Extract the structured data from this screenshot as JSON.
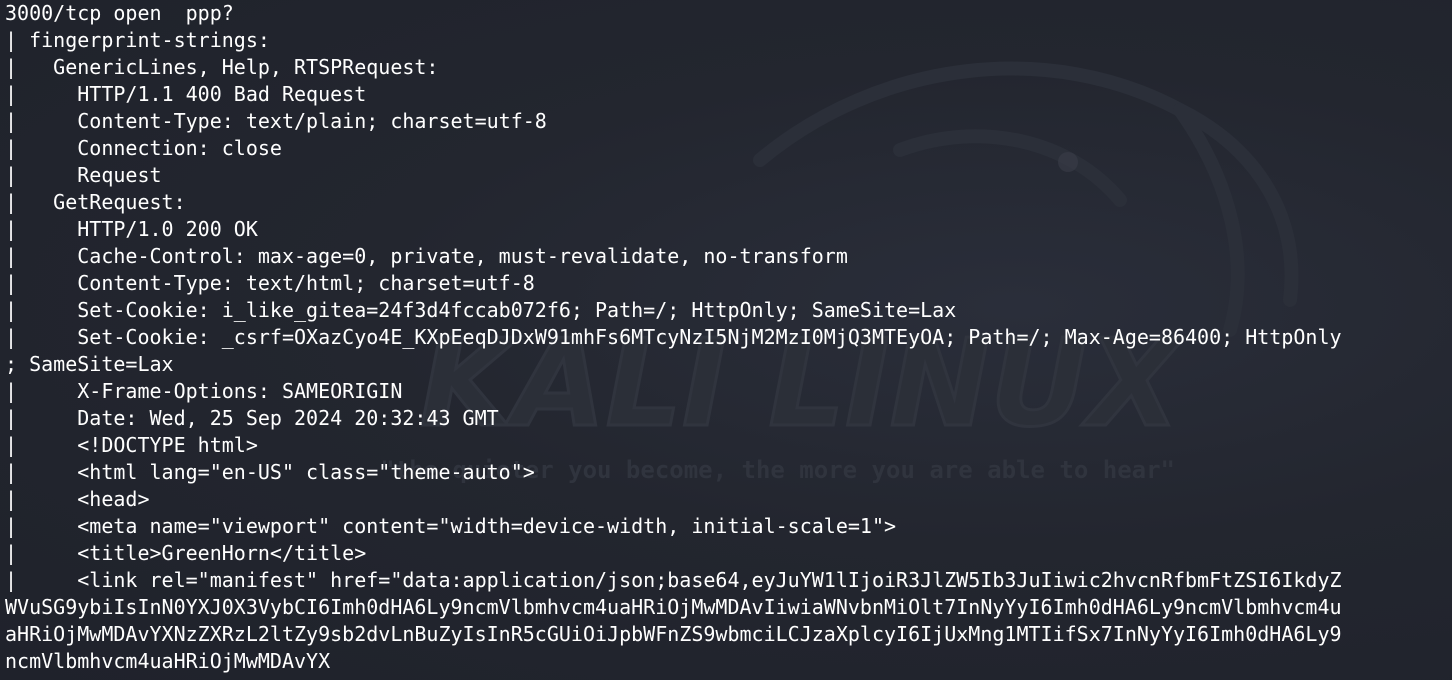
{
  "colors": {
    "background": "#23262f",
    "foreground": "#ffffff",
    "watermark": "#2c3039"
  },
  "watermark": {
    "logo_text": "KALI LINUX",
    "tagline": "\"the quieter you become, the more you are able to hear\"",
    "icon": "kali-dragon-icon"
  },
  "lines": [
    "3000/tcp open  ppp?",
    "| fingerprint-strings:",
    "|   GenericLines, Help, RTSPRequest:",
    "|     HTTP/1.1 400 Bad Request",
    "|     Content-Type: text/plain; charset=utf-8",
    "|     Connection: close",
    "|     Request",
    "|   GetRequest:",
    "|     HTTP/1.0 200 OK",
    "|     Cache-Control: max-age=0, private, must-revalidate, no-transform",
    "|     Content-Type: text/html; charset=utf-8",
    "|     Set-Cookie: i_like_gitea=24f3d4fccab072f6; Path=/; HttpOnly; SameSite=Lax",
    "|     Set-Cookie: _csrf=OXazCyo4E_KXpEeqDJDxW91mhFs6MTcyNzI5NjM2MzI0MjQ3MTEyOA; Path=/; Max-Age=86400; HttpOnly",
    "; SameSite=Lax",
    "|     X-Frame-Options: SAMEORIGIN",
    "|     Date: Wed, 25 Sep 2024 20:32:43 GMT",
    "|     <!DOCTYPE html>",
    "|     <html lang=\"en-US\" class=\"theme-auto\">",
    "|     <head>",
    "|     <meta name=\"viewport\" content=\"width=device-width, initial-scale=1\">",
    "|     <title>GreenHorn</title>",
    "|     <link rel=\"manifest\" href=\"data:application/json;base64,eyJuYW1lIjoiR3JlZW5Ib3JuIiwic2hvcnRfbmFtZSI6IkdyZ",
    "WVuSG9ybiIsInN0YXJ0X3VybCI6Imh0dHA6Ly9ncmVlbmhvcm4uaHRiOjMwMDAvIiwiaWNvbnMiOlt7InNyYyI6Imh0dHA6Ly9ncmVlbmhvcm4u",
    "aHRiOjMwMDAvYXNzZXRzL2ltZy9sb2dvLnBuZyIsInR5cGUiOiJpbWFnZS9wbmciLCJzaXplcyI6IjUxMng1MTIifSx7InNyYyI6Imh0dHA6Ly9",
    "ncmVlbmhvcm4uaHRiOjMwMDAvYX"
  ]
}
